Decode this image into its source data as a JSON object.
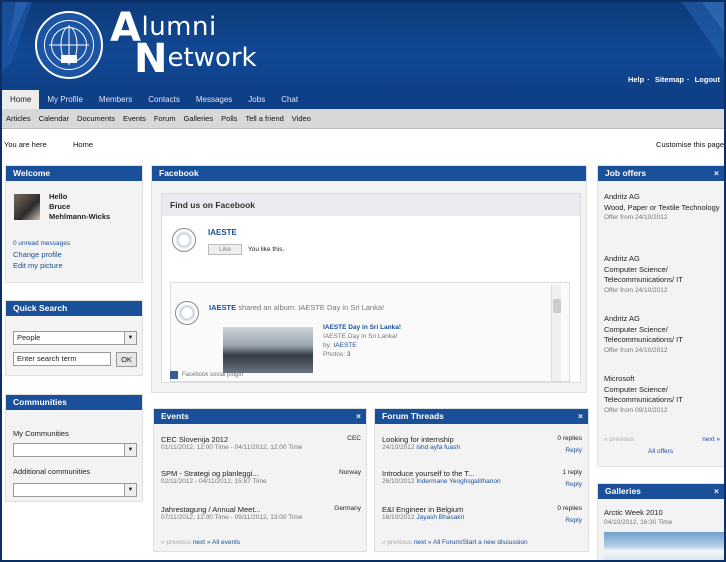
{
  "header": {
    "title_line1": "Alumni",
    "title_line2": "Network",
    "top_links": [
      "Help",
      "Sitemap",
      "Logout"
    ]
  },
  "nav_main": [
    "Home",
    "My Profile",
    "Members",
    "Contacts",
    "Messages",
    "Jobs",
    "Chat"
  ],
  "nav_sub": [
    "Articles",
    "Calendar",
    "Documents",
    "Events",
    "Forum",
    "Galleries",
    "Polls",
    "Tell a friend",
    "Video"
  ],
  "breadcrumb": {
    "label": "You are here",
    "home": "Home",
    "customise": "Customise this page"
  },
  "welcome": {
    "title": "Welcome",
    "hello": "Hello",
    "first_name": "Bruce",
    "last_name": "Mehlmann-Wicks",
    "unread": "0 unread messages",
    "change_profile": "Change profile",
    "edit_picture": "Edit my picture"
  },
  "quick_search": {
    "title": "Quick Search",
    "type": "People",
    "placeholder": "Enter search term",
    "ok": "OK"
  },
  "communities": {
    "title": "Communities",
    "my_label": "My Communities",
    "additional_label": "Additional communities"
  },
  "facebook": {
    "title": "Facebook",
    "find_us": "Find us on Facebook",
    "page_name": "IAESTE",
    "like": "Like",
    "you_like": "You like this.",
    "post_author": "IAESTE",
    "post_text": "shared an album: IAESTE Day in Sri Lanka!",
    "album_title": "IAESTE Day in Sri Lanka!",
    "album_sub": "IAESTE Day in Sri Lanka!",
    "album_by": "IAESTE",
    "photos": "3",
    "plugin": "Facebook social plugin"
  },
  "events": {
    "title": "Events",
    "items": [
      {
        "name": "CEC Slovenija 2012",
        "place": "CEC",
        "date": "01/11/2012, 12:00 Time - 04/11/2012, 12:00 Time"
      },
      {
        "name": "SPM - Strategi og planleggi...",
        "place": "Norway",
        "date": "02/11/2012 - 04/11/2012, 15:87 Time"
      },
      {
        "name": "Jahrestagung / Annual Meet...",
        "place": "Germany",
        "date": "07/11/2012, 12:00 Time - 09/11/2012, 13:00 Time"
      }
    ],
    "footer_prev": "« previous",
    "footer_next": "next »",
    "footer_all": "All events"
  },
  "forum": {
    "title": "Forum Threads",
    "items": [
      {
        "title": "Looking for internship",
        "replies": "0 replies",
        "date": "24/10/2012",
        "author": "ishd ayfa fuash",
        "reply": "Reply"
      },
      {
        "title": "Introduce yourself to the T...",
        "replies": "1 reply",
        "date": "26/10/2012",
        "author": "Indermane Yeoghsgalithanon",
        "reply": "Reply"
      },
      {
        "title": "E&I Engineer in Belgium",
        "replies": "0 replies",
        "date": "16/10/2012",
        "author": "Jayash Bhasakri",
        "reply": "Reply"
      }
    ],
    "footer_prev": "« previous",
    "footer_next": "next »",
    "footer_all": "All Forum/Start a new discussion"
  },
  "jobs": {
    "title": "Job offers",
    "items": [
      {
        "company": "Andritz AG",
        "field": "Wood, Paper or Textile Technology",
        "offer": "Offer from 24/10/2012"
      },
      {
        "company": "Andritz AG",
        "field": "Computer Science/ Telecommunications/ IT",
        "offer": "Offer from 24/10/2012"
      },
      {
        "company": "Andritz AG",
        "field": "Computer Science/ Telecommunications/ IT",
        "offer": "Offer from 24/10/2012"
      },
      {
        "company": "Microsoft",
        "field": "Computer Science/ Telecommunications/ IT",
        "offer": "Offer from 09/10/2012"
      }
    ],
    "prev": "« previous",
    "next": "next »",
    "all": "All offers"
  },
  "galleries": {
    "title": "Galleries",
    "name": "Arctic Week 2010",
    "date": "04/10/2012, 16:30 Time"
  },
  "colors": {
    "brand": "#114894",
    "nav": "#0f3f86",
    "box_header": "#1a4f9a"
  }
}
